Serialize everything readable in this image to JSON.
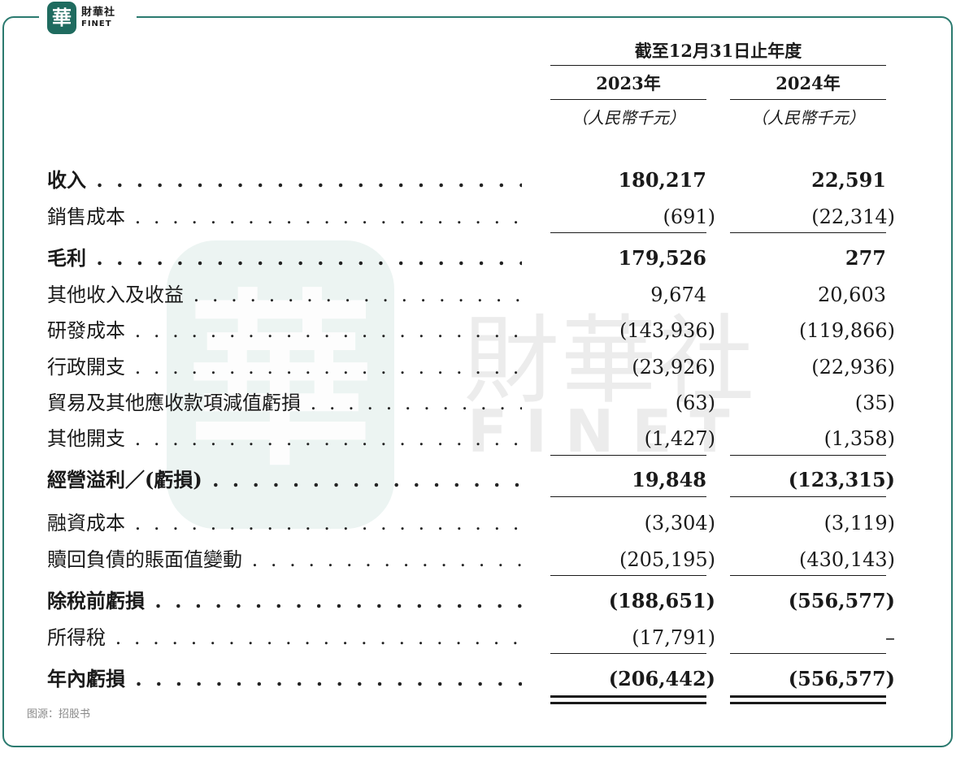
{
  "brand": {
    "seal": "華",
    "name_cn": "財華社",
    "name_en": "FINET"
  },
  "watermark": {
    "seal": "華",
    "name_cn": "財華社",
    "name_en": "FINET"
  },
  "header": {
    "period": "截至12月31日止年度",
    "col1": "2023年",
    "col2": "2024年",
    "unit1": "（人民幣千元）",
    "unit2": "（人民幣千元）"
  },
  "rows": [
    {
      "label": "收入",
      "bold": true,
      "v2023": "180,217",
      "v2024": "22,591"
    },
    {
      "label": "銷售成本",
      "bold": false,
      "v2023": "(691)",
      "v2024": "(22,314)"
    },
    {
      "label": "毛利",
      "bold": true,
      "v2023": "179,526",
      "v2024": "277"
    },
    {
      "label": "其他收入及收益",
      "bold": false,
      "v2023": "9,674",
      "v2024": "20,603"
    },
    {
      "label": "研發成本",
      "bold": false,
      "v2023": "(143,936)",
      "v2024": "(119,866)"
    },
    {
      "label": "行政開支",
      "bold": false,
      "v2023": "(23,926)",
      "v2024": "(22,936)"
    },
    {
      "label": "貿易及其他應收款項減值虧損",
      "bold": false,
      "v2023": "(63)",
      "v2024": "(35)"
    },
    {
      "label": "其他開支",
      "bold": false,
      "v2023": "(1,427)",
      "v2024": "(1,358)"
    },
    {
      "label": "經營溢利／(虧損)",
      "bold": true,
      "v2023": "19,848",
      "v2024": "(123,315)"
    },
    {
      "label": "融資成本",
      "bold": false,
      "v2023": "(3,304)",
      "v2024": "(3,119)"
    },
    {
      "label": "贖回負債的賬面值變動",
      "bold": false,
      "v2023": "(205,195)",
      "v2024": "(430,143)"
    },
    {
      "label": "除稅前虧損",
      "bold": true,
      "v2023": "(188,651)",
      "v2024": "(556,577)"
    },
    {
      "label": "所得稅",
      "bold": false,
      "v2023": "(17,791)",
      "v2024": "–"
    },
    {
      "label": "年內虧損",
      "bold": true,
      "v2023": "(206,442)",
      "v2024": "(556,577)"
    }
  ],
  "source": "图源：招股书"
}
